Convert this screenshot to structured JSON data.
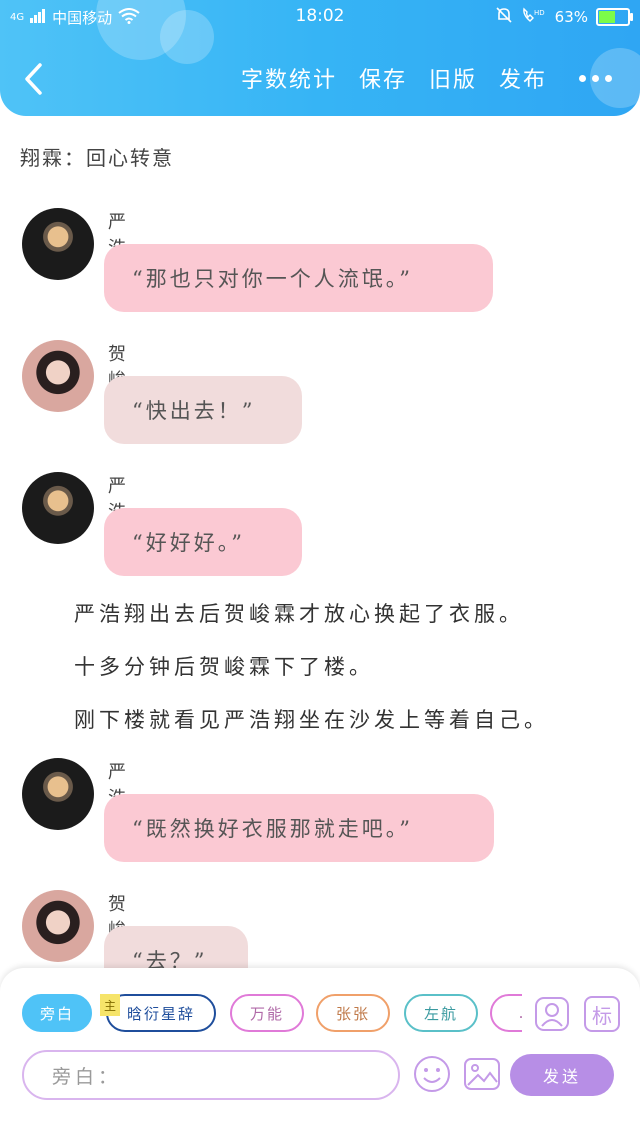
{
  "status_bar": {
    "carrier": "中国移动",
    "network": "4G",
    "time": "18:02",
    "battery": "63%",
    "battery_level": 0.63
  },
  "header": {
    "actions": [
      "字数统计",
      "保存",
      "旧版",
      "发布"
    ]
  },
  "chapter_title": "翔霖：回心转意",
  "messages": [
    {
      "name": "严浩翔",
      "text": "“那也只对你一个人流氓。”"
    },
    {
      "name": "贺峻霖",
      "text": "“快出去！”"
    },
    {
      "name": "严浩翔",
      "text": "“好好好。”"
    },
    {
      "name": "严浩翔",
      "text": "“既然换好衣服那就走吧。”"
    },
    {
      "name": "贺峻霖",
      "text": "“去？”"
    }
  ],
  "narration": [
    "严浩翔出去后贺峻霖才放心换起了衣服。",
    "十多分钟后贺峻霖下了楼。",
    "刚下楼就看见严浩翔坐在沙发上等着自己。"
  ],
  "bottom_bar": {
    "chips": [
      "旁白",
      "晗衍星辞",
      "万能",
      "张张",
      "左航",
      "…"
    ],
    "main_badge": "主",
    "input_placeholder": "旁白：",
    "send_label": "发送",
    "tag_icon_label": "标"
  },
  "colors": {
    "header": "#36b4f5",
    "bubble_pink": "#fbc9d3",
    "bubble_beige": "#f1dcdc",
    "send": "#b78ee6"
  }
}
